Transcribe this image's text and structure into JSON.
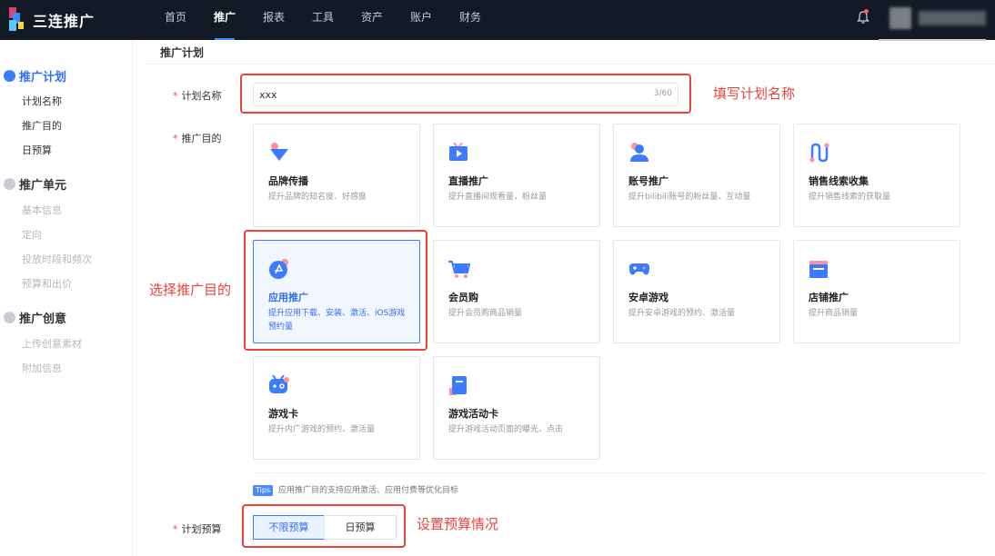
{
  "app": {
    "brand": "三连推广"
  },
  "topnav": {
    "items": [
      "首页",
      "推广",
      "报表",
      "工具",
      "资产",
      "账户",
      "财务"
    ],
    "active_index": 1
  },
  "sidebar": {
    "sections": [
      {
        "label": "推广计划",
        "active": true,
        "items": [
          "计划名称",
          "推广目的",
          "日预算"
        ]
      },
      {
        "label": "推广单元",
        "active": false,
        "items": [
          "基本信息",
          "定向",
          "投放时段和频次",
          "预算和出价"
        ]
      },
      {
        "label": "推广创意",
        "active": false,
        "items": [
          "上传创意素材",
          "附加信息"
        ]
      }
    ]
  },
  "main": {
    "title": "推广计划",
    "plan_name": {
      "label": "计划名称",
      "value": "xxx",
      "counter": "3/60"
    },
    "purpose": {
      "label": "推广目的",
      "cards": [
        {
          "title": "品牌传播",
          "desc": "提升品牌的知名度、好感度",
          "icon": "diamond-icon"
        },
        {
          "title": "直播推广",
          "desc": "提升直播间观看量，粉丝量",
          "icon": "tv-icon"
        },
        {
          "title": "账号推广",
          "desc": "提升bilibili账号的粉丝量、互动量",
          "icon": "user-icon"
        },
        {
          "title": "销售线索收集",
          "desc": "提升销售线索的获取量",
          "icon": "route-icon"
        },
        {
          "title": "应用推广",
          "desc": "提升应用下载、安装、激活、iOS游戏预约量",
          "icon": "app-store-icon",
          "selected": true
        },
        {
          "title": "会员购",
          "desc": "提升会员购商品销量",
          "icon": "cart-icon"
        },
        {
          "title": "安卓游戏",
          "desc": "提升安卓游戏的预约、激活量",
          "icon": "gamepad-icon"
        },
        {
          "title": "店铺推广",
          "desc": "提升商品销量",
          "icon": "shop-icon"
        },
        {
          "title": "游戏卡",
          "desc": "提升内广游戏的预约、激活量",
          "icon": "game-card-icon"
        },
        {
          "title": "游戏活动卡",
          "desc": "提升游戏活动页面的曝光、点击",
          "icon": "bookmark-icon"
        }
      ]
    },
    "tips": {
      "tag": "Tips",
      "text": "应用推广目的支持应用激活、应用付费等优化目标"
    },
    "budget": {
      "label": "计划预算",
      "options": [
        "不限预算",
        "日预算"
      ],
      "selected_index": 0
    }
  },
  "annotations": {
    "name": "填写计划名称",
    "purpose": "选择推广目的",
    "budget": "设置预算情况"
  },
  "colors": {
    "accent": "#3a7bff",
    "annotation": "#e8443a",
    "topbar": "#121a26"
  }
}
